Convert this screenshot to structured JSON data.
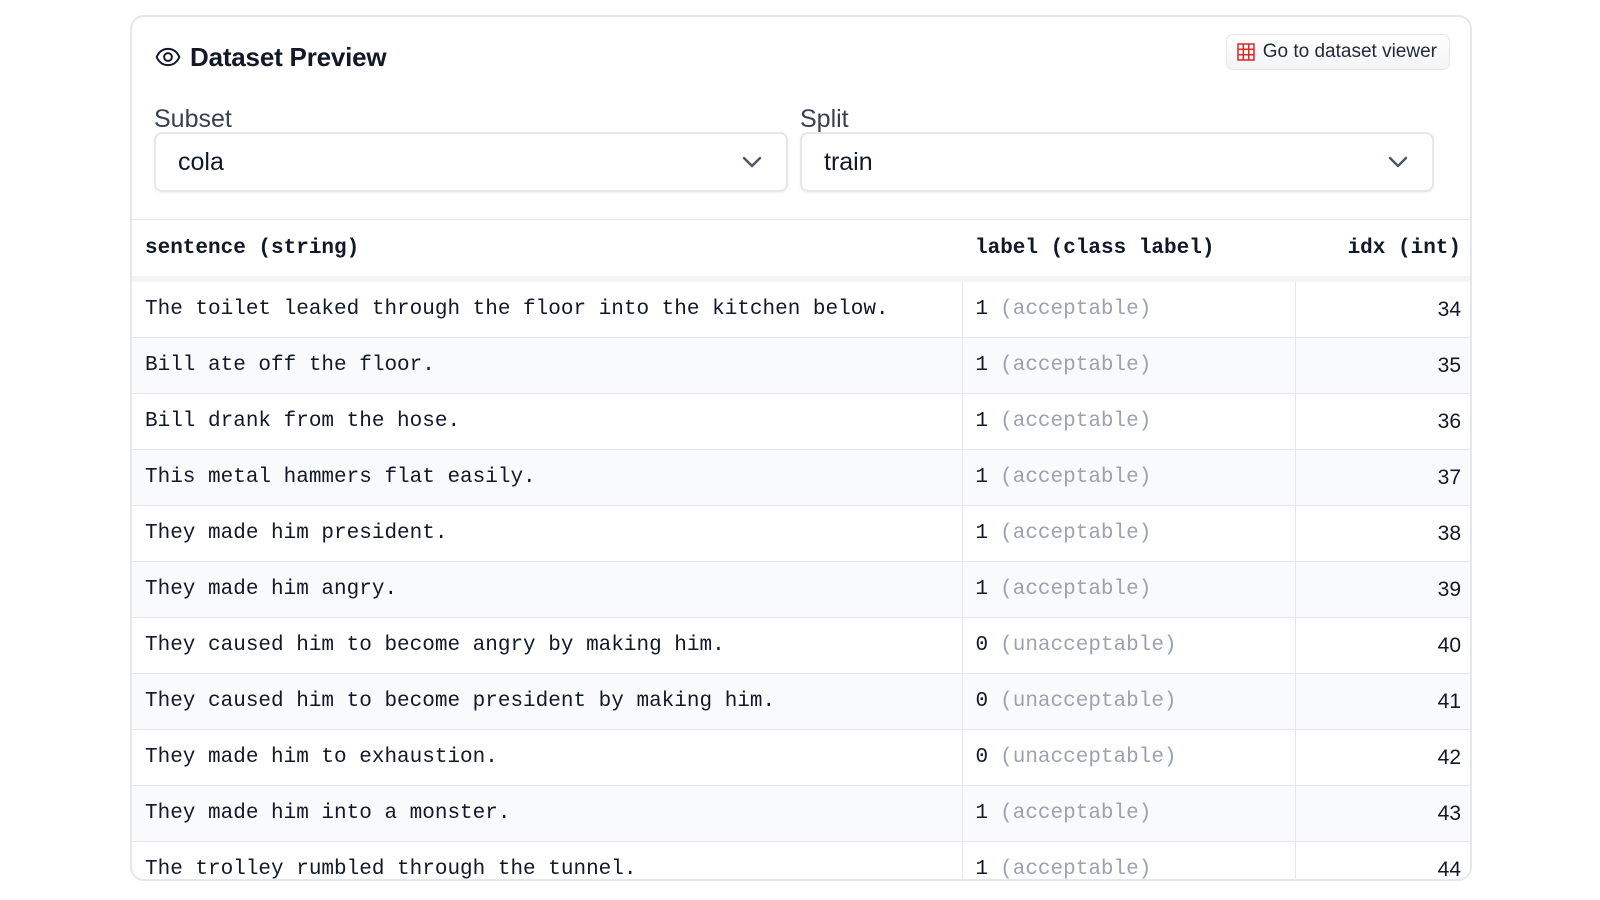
{
  "header": {
    "icon": "eye-icon",
    "title": "Dataset Preview",
    "viewer_button": {
      "icon": "grid-icon",
      "label": "Go to dataset viewer",
      "icon_color": "#dc2626"
    }
  },
  "subset": {
    "label": "Subset",
    "value": "cola"
  },
  "split": {
    "label": "Split",
    "value": "train"
  },
  "table": {
    "columns": [
      "sentence (string)",
      "label (class label)",
      "idx (int)"
    ],
    "rows": [
      {
        "sentence": "The toilet leaked through the floor into the kitchen below.",
        "label_num": "1",
        "label_name": "(acceptable)",
        "idx": "34"
      },
      {
        "sentence": "Bill ate off the floor.",
        "label_num": "1",
        "label_name": "(acceptable)",
        "idx": "35"
      },
      {
        "sentence": "Bill drank from the hose.",
        "label_num": "1",
        "label_name": "(acceptable)",
        "idx": "36"
      },
      {
        "sentence": "This metal hammers flat easily.",
        "label_num": "1",
        "label_name": "(acceptable)",
        "idx": "37"
      },
      {
        "sentence": "They made him president.",
        "label_num": "1",
        "label_name": "(acceptable)",
        "idx": "38"
      },
      {
        "sentence": "They made him angry.",
        "label_num": "1",
        "label_name": "(acceptable)",
        "idx": "39"
      },
      {
        "sentence": "They caused him to become angry by making him.",
        "label_num": "0",
        "label_name": "(unacceptable)",
        "idx": "40"
      },
      {
        "sentence": "They caused him to become president by making him.",
        "label_num": "0",
        "label_name": "(unacceptable)",
        "idx": "41"
      },
      {
        "sentence": "They made him to exhaustion.",
        "label_num": "0",
        "label_name": "(unacceptable)",
        "idx": "42"
      },
      {
        "sentence": "They made him into a monster.",
        "label_num": "1",
        "label_name": "(acceptable)",
        "idx": "43"
      },
      {
        "sentence": "The trolley rumbled through the tunnel.",
        "label_num": "1",
        "label_name": "(acceptable)",
        "idx": "44"
      }
    ]
  }
}
